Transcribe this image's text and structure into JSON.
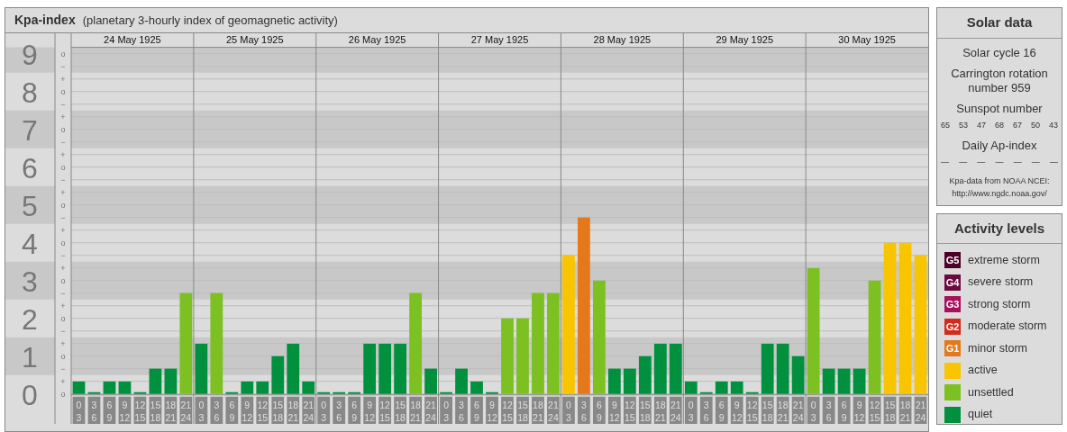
{
  "kpa_chart": {
    "title": "Kpa-index",
    "subtitle": "(planetary 3-hourly index of geomagnetic activity)",
    "days": [
      "24 May 1925",
      "25 May 1925",
      "26 May 1925",
      "27 May 1925",
      "28 May 1925",
      "29 May 1925",
      "30 May 1925"
    ],
    "sub_ticks": [
      "o",
      "−",
      "+",
      "o",
      "−",
      "+",
      "o",
      "−",
      "+",
      "o",
      "−",
      "+",
      "o",
      "−",
      "+",
      "o",
      "−",
      "+",
      "o",
      "−",
      "+",
      "o",
      "−",
      "+",
      "o",
      "−",
      "+",
      "o"
    ],
    "chart_data": {
      "type": "bar",
      "ylim": [
        0,
        9.17
      ],
      "grid": true,
      "yticks": [
        {
          "value": 0,
          "label": "0"
        },
        {
          "value": 1,
          "label": "1"
        },
        {
          "value": 2,
          "label": "2"
        },
        {
          "value": 3,
          "label": "3"
        },
        {
          "value": 4,
          "label": "4"
        },
        {
          "value": 5,
          "label": "5"
        },
        {
          "value": 6,
          "label": "6"
        },
        {
          "value": 7,
          "label": "7"
        },
        {
          "value": 8,
          "label": "8"
        },
        {
          "value": 9,
          "label": "9"
        }
      ],
      "categories": [
        "0 3",
        "3 6",
        "6 9",
        "9 12",
        "12 15",
        "15 18",
        "18 21",
        "21 24",
        "0 3",
        "3 6",
        "6 9",
        "9 12",
        "12 15",
        "15 18",
        "18 21",
        "21 24",
        "0 3",
        "3 6",
        "6 9",
        "9 12",
        "12 15",
        "15 18",
        "18 21",
        "21 24",
        "0 3",
        "3 6",
        "6 9",
        "9 12",
        "12 15",
        "15 18",
        "18 21",
        "21 24",
        "0 3",
        "3 6",
        "6 9",
        "9 12",
        "12 15",
        "15 18",
        "18 21",
        "21 24",
        "0 3",
        "3 6",
        "6 9",
        "9 12",
        "12 15",
        "15 18",
        "18 21",
        "21 24",
        "0 3",
        "3 6",
        "6 9",
        "9 12",
        "12 15",
        "15 18",
        "18 21",
        "21 24"
      ],
      "series": [
        {
          "values": [
            0.33,
            0,
            0.33,
            0.33,
            0,
            0.67,
            0.67,
            2.67,
            1.33,
            2.67,
            0,
            0.33,
            0.33,
            1,
            1.33,
            0.33,
            0,
            0,
            0,
            1.33,
            1.33,
            1.33,
            2.67,
            0.67,
            0,
            0.67,
            0.33,
            0,
            2,
            2,
            2.67,
            2.67,
            3.67,
            4.67,
            3,
            0.67,
            0.67,
            1,
            1.33,
            1.33,
            0.33,
            0,
            0.33,
            0.33,
            0,
            1.33,
            1.33,
            1,
            3.33,
            0.67,
            0.67,
            0.67,
            3,
            4,
            4,
            3.67
          ]
        }
      ]
    }
  },
  "solar_data": {
    "title": "Solar data",
    "solar_cycle": "Solar cycle 16",
    "carrington_rotation": "Carrington rotation number 959",
    "sunspot_heading": "Sunspot number",
    "sunspot_numbers": [
      "65",
      "53",
      "47",
      "68",
      "67",
      "50",
      "43"
    ],
    "ap_heading": "Daily Ap-index",
    "ap_values": [
      "—",
      "—",
      "—",
      "—",
      "—",
      "—",
      "—"
    ],
    "source": "Kpa-data from NOAA NCEI:",
    "source_url": "http://www.ngdc.noaa.gov/"
  },
  "activity_levels": {
    "title": "Activity levels",
    "items": [
      {
        "badge": "G5",
        "label": "extreme storm",
        "color": "#4e0026"
      },
      {
        "badge": "G4",
        "label": "severe storm",
        "color": "#6c0a3e"
      },
      {
        "badge": "G3",
        "label": "strong storm",
        "color": "#a8105e"
      },
      {
        "badge": "G2",
        "label": "moderate storm",
        "color": "#d42a1a"
      },
      {
        "badge": "G1",
        "label": "minor storm",
        "color": "#e5781a"
      },
      {
        "label": "active",
        "color": "#f8c500"
      },
      {
        "label": "unsettled",
        "color": "#7cc022"
      },
      {
        "label": "quiet",
        "color": "#00903e"
      }
    ]
  }
}
